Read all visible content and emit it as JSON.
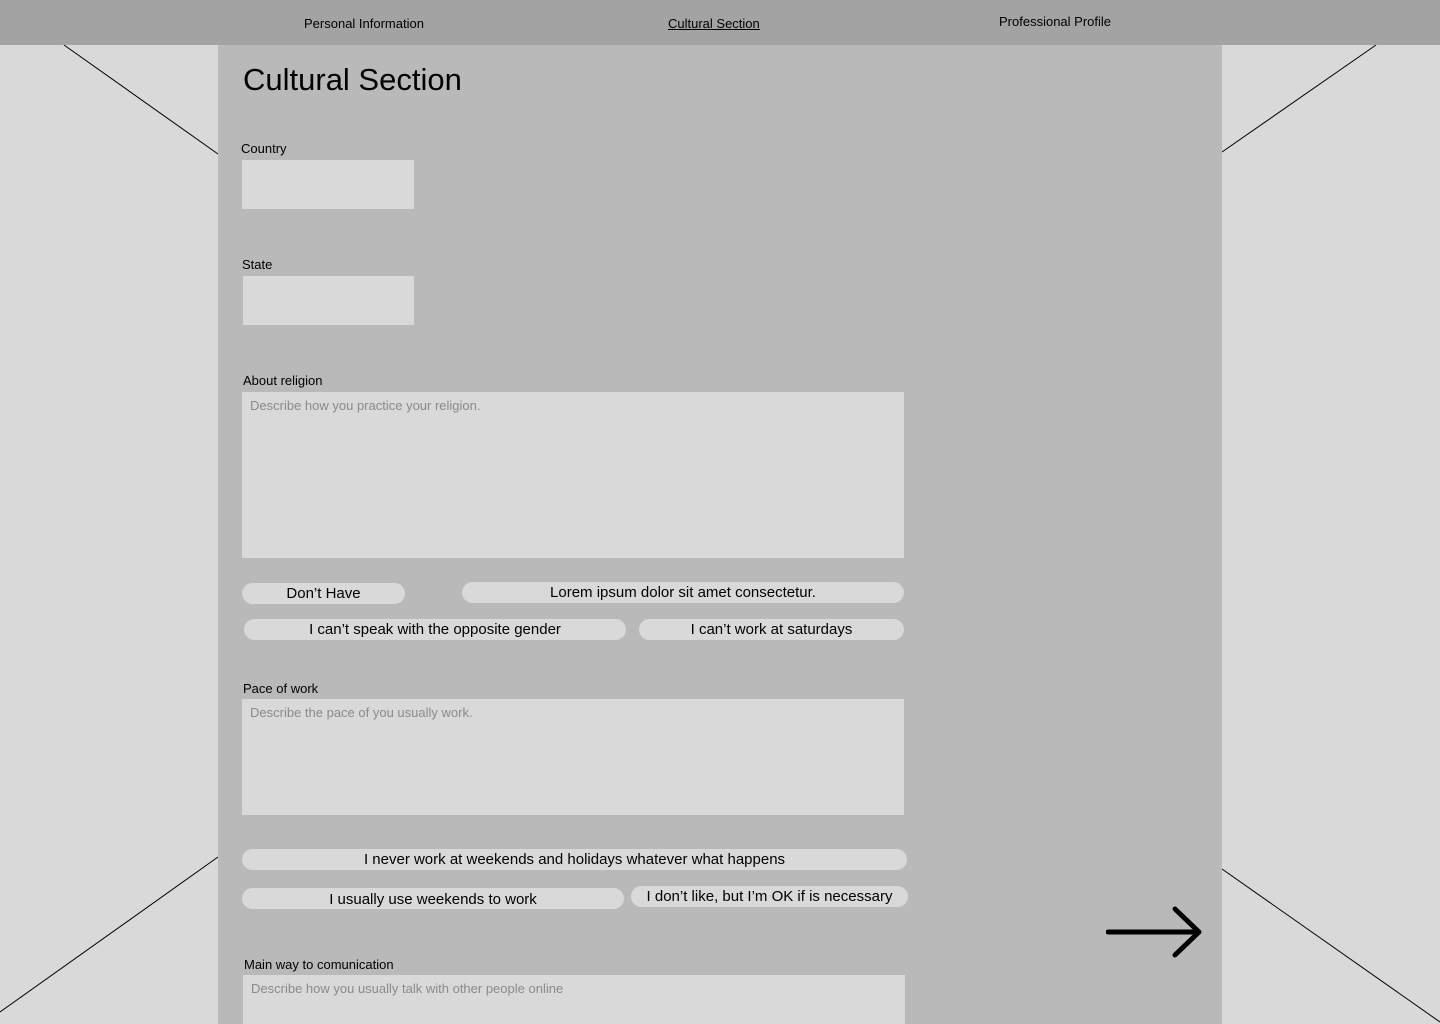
{
  "nav": {
    "personal_information": "Personal Information",
    "cultural_section": "Cultural Section",
    "professional_profile": "Professional Profile"
  },
  "page": {
    "title": "Cultural Section"
  },
  "form": {
    "country": {
      "label": "Country",
      "value": ""
    },
    "state": {
      "label": "State",
      "value": ""
    },
    "religion": {
      "label": "About religion",
      "placeholder": "Describe how you practice your religion.",
      "chips": [
        "Don’t Have",
        "Lorem ipsum dolor sit amet consectetur.",
        "I can’t speak with the opposite gender",
        "I can’t work at saturdays"
      ]
    },
    "pace": {
      "label": "Pace of work",
      "placeholder": "Describe the pace of you usually work.",
      "chips": [
        "I never work at weekends and holidays whatever what happens",
        "I usually use weekends to work",
        "I don’t like, but I’m OK if is necessary"
      ]
    },
    "communication": {
      "label": "Main way to comunication",
      "placeholder": "Describe how you usually talk with other people online"
    }
  },
  "icons": {
    "next": "arrow-right-icon"
  },
  "colors": {
    "background": "#d9d9d9",
    "topbar": "#a3a3a3",
    "panel": "#b9b9b9",
    "field": "#d9d9d9",
    "placeholder": "#8a8a8a"
  }
}
